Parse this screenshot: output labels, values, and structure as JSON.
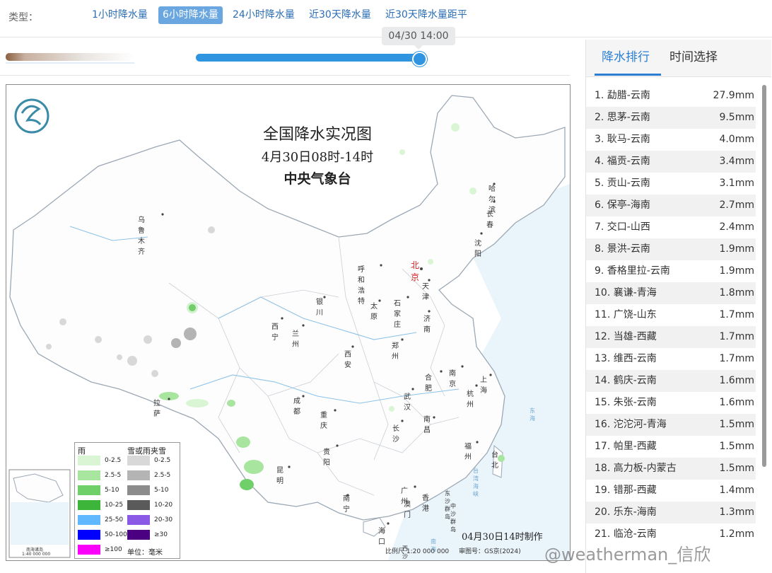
{
  "type_bar": {
    "label": "类型：",
    "tabs": [
      "1小时降水量",
      "6小时降水量",
      "24小时降水量",
      "近30天降水量",
      "近30天降水量距平"
    ],
    "active_index": 1
  },
  "timeline": {
    "current_time": "04/30 14:00",
    "progress": 1.0
  },
  "map": {
    "title": "全国降水实况图",
    "period": "4月30日08时-14时",
    "agency": "中央气象台",
    "made_time": "04月30日14时制作",
    "scale": "比例尺 1:20 000 000",
    "review_no": "审图号：GS京(2024)",
    "inset_label_1": "南海诸岛",
    "inset_label_2": "1:40 000 000",
    "cities": [
      "乌鲁木齐",
      "哈尔滨",
      "长春",
      "沈阳",
      "呼和浩特",
      "北京",
      "天津",
      "银川",
      "太原",
      "石家庄",
      "济南",
      "西宁",
      "兰州",
      "郑州",
      "西安",
      "合肥",
      "南京",
      "上海",
      "杭州",
      "武汉",
      "成都",
      "拉萨",
      "重庆",
      "长沙",
      "南昌",
      "福州",
      "台北",
      "贵阳",
      "昆明",
      "广州",
      "澳门",
      "香港",
      "南宁",
      "海口"
    ],
    "seas": [
      "东海",
      "台湾海峡",
      "南海",
      "东沙群岛",
      "西沙群岛",
      "中沙群岛"
    ],
    "legend": {
      "rain_title": "雨",
      "snow_title": "雪或雨夹雪",
      "rain_items": [
        {
          "label": "0-2.5",
          "color": "#d9f5d4"
        },
        {
          "label": "2.5-5",
          "color": "#a8e6a0"
        },
        {
          "label": "5-10",
          "color": "#6fd06a"
        },
        {
          "label": "10-25",
          "color": "#3db43a"
        },
        {
          "label": "25-50",
          "color": "#61b8ff"
        },
        {
          "label": "50-100",
          "color": "#0000fe"
        },
        {
          "label": "≥100",
          "color": "#fa00fa"
        }
      ],
      "snow_items": [
        {
          "label": "0-2.5",
          "color": "#d8d8d8"
        },
        {
          "label": "2.5-5",
          "color": "#b4b4b4"
        },
        {
          "label": "5-10",
          "color": "#8c8c8c"
        },
        {
          "label": "10-20",
          "color": "#5a5a5a"
        },
        {
          "label": "20-30",
          "color": "#8a5ae6"
        },
        {
          "label": "≥30",
          "color": "#4b0082"
        }
      ],
      "unit": "单位：毫米"
    }
  },
  "side_panel": {
    "tabs": [
      "降水排行",
      "时间选择"
    ],
    "active_index": 0,
    "ranking": [
      {
        "name": "1. 勐腊-云南",
        "value": "27.9mm"
      },
      {
        "name": "2. 思茅-云南",
        "value": "9.5mm"
      },
      {
        "name": "3. 耿马-云南",
        "value": "4.0mm"
      },
      {
        "name": "4. 福贡-云南",
        "value": "3.4mm"
      },
      {
        "name": "5. 贡山-云南",
        "value": "3.1mm"
      },
      {
        "name": "6. 保亭-海南",
        "value": "2.7mm"
      },
      {
        "name": "7. 交口-山西",
        "value": "2.4mm"
      },
      {
        "name": "8. 景洪-云南",
        "value": "1.9mm"
      },
      {
        "name": "9. 香格里拉-云南",
        "value": "1.9mm"
      },
      {
        "name": "10. 襄谦-青海",
        "value": "1.8mm"
      },
      {
        "name": "11. 广饶-山东",
        "value": "1.7mm"
      },
      {
        "name": "12. 当雄-西藏",
        "value": "1.7mm"
      },
      {
        "name": "13. 维西-云南",
        "value": "1.7mm"
      },
      {
        "name": "14. 鹤庆-云南",
        "value": "1.6mm"
      },
      {
        "name": "15. 朱张-云南",
        "value": "1.6mm"
      },
      {
        "name": "16. 沱沱河-青海",
        "value": "1.5mm"
      },
      {
        "name": "17. 帕里-西藏",
        "value": "1.5mm"
      },
      {
        "name": "18. 高力板-内蒙古",
        "value": "1.5mm"
      },
      {
        "name": "19. 错那-西藏",
        "value": "1.4mm"
      },
      {
        "name": "20. 乐东-海南",
        "value": "1.3mm"
      },
      {
        "name": "21. 临沧-云南",
        "value": "1.2mm"
      }
    ]
  },
  "watermark": "@weatherman_信欣",
  "colors": {
    "accent": "#2a7fd4",
    "slider": "#2f95e0",
    "tab_active_bg": "#6aa6e0"
  }
}
